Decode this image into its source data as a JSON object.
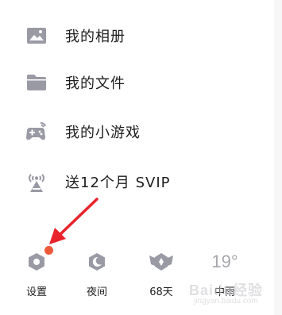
{
  "menu": {
    "items": [
      {
        "label": "我的相册",
        "icon": "photo-album-icon"
      },
      {
        "label": "我的文件",
        "icon": "folder-icon"
      },
      {
        "label": "我的小游戏",
        "icon": "gamepad-icon"
      },
      {
        "label": "送12个月 SVIP",
        "icon": "broadcast-tower-icon"
      }
    ]
  },
  "bottom_bar": {
    "settings_label": "设置",
    "night_label": "夜间",
    "days_label": "68天",
    "temperature": "19°",
    "weather_label": "中雨"
  },
  "watermark": {
    "text": "Baidu经验",
    "url": "jingyan.baidu.com"
  },
  "colors": {
    "icon": "#9a9aa5",
    "badge": "#ec5a3a",
    "arrow": "#e8232b",
    "text": "#1d1d1f"
  }
}
